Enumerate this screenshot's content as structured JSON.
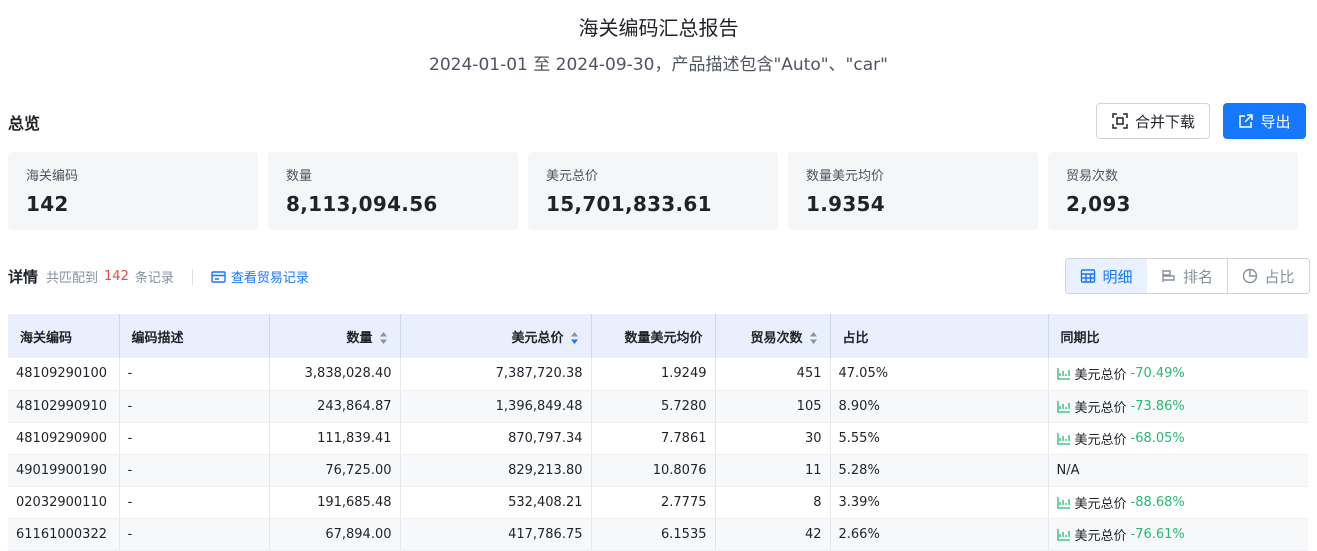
{
  "report": {
    "title": "海关编码汇总报告",
    "subtitle": "2024-01-01 至 2024-09-30，产品描述包含\"Auto\"、\"car\""
  },
  "overview": {
    "label": "总览",
    "merge_download": "合并下载",
    "export": "导出",
    "cards": [
      {
        "label": "海关编码",
        "value": "142"
      },
      {
        "label": "数量",
        "value": "8,113,094.56"
      },
      {
        "label": "美元总价",
        "value": "15,701,833.61"
      },
      {
        "label": "数量美元均价",
        "value": "1.9354"
      },
      {
        "label": "贸易次数",
        "value": "2,093"
      }
    ]
  },
  "details": {
    "label": "详情",
    "match_prefix": "共匹配到",
    "match_count": "142",
    "match_suffix": "条记录",
    "view_trades": "查看贸易记录",
    "views": [
      "明细",
      "排名",
      "占比"
    ]
  },
  "table": {
    "headers": [
      "海关编码",
      "编码描述",
      "数量",
      "美元总价",
      "数量美元均价",
      "贸易次数",
      "占比",
      "同期比"
    ],
    "rows": [
      {
        "code": "48109290100",
        "desc": "-",
        "qty": "3,838,028.40",
        "usd": "7,387,720.38",
        "avg": "1.9249",
        "trades": "451",
        "share": "47.05%",
        "yoy_label": "美元总价",
        "yoy_value": "-70.49%"
      },
      {
        "code": "48102990910",
        "desc": "-",
        "qty": "243,864.87",
        "usd": "1,396,849.48",
        "avg": "5.7280",
        "trades": "105",
        "share": "8.90%",
        "yoy_label": "美元总价",
        "yoy_value": "-73.86%"
      },
      {
        "code": "48109290900",
        "desc": "-",
        "qty": "111,839.41",
        "usd": "870,797.34",
        "avg": "7.7861",
        "trades": "30",
        "share": "5.55%",
        "yoy_label": "美元总价",
        "yoy_value": "-68.05%"
      },
      {
        "code": "49019900190",
        "desc": "-",
        "qty": "76,725.00",
        "usd": "829,213.80",
        "avg": "10.8076",
        "trades": "11",
        "share": "5.28%",
        "yoy_label": "",
        "yoy_value": "N/A"
      },
      {
        "code": "02032900110",
        "desc": "-",
        "qty": "191,685.48",
        "usd": "532,408.21",
        "avg": "2.7775",
        "trades": "8",
        "share": "3.39%",
        "yoy_label": "美元总价",
        "yoy_value": "-88.68%"
      },
      {
        "code": "61161000322",
        "desc": "-",
        "qty": "67,894.00",
        "usd": "417,786.75",
        "avg": "6.1535",
        "trades": "42",
        "share": "2.66%",
        "yoy_label": "美元总价",
        "yoy_value": "-76.61%"
      }
    ]
  },
  "colors": {
    "accent": "#1677ff",
    "negative_yoy": "#2bb673",
    "match_count": "#e5484d",
    "header_bg": "#e9effc"
  }
}
